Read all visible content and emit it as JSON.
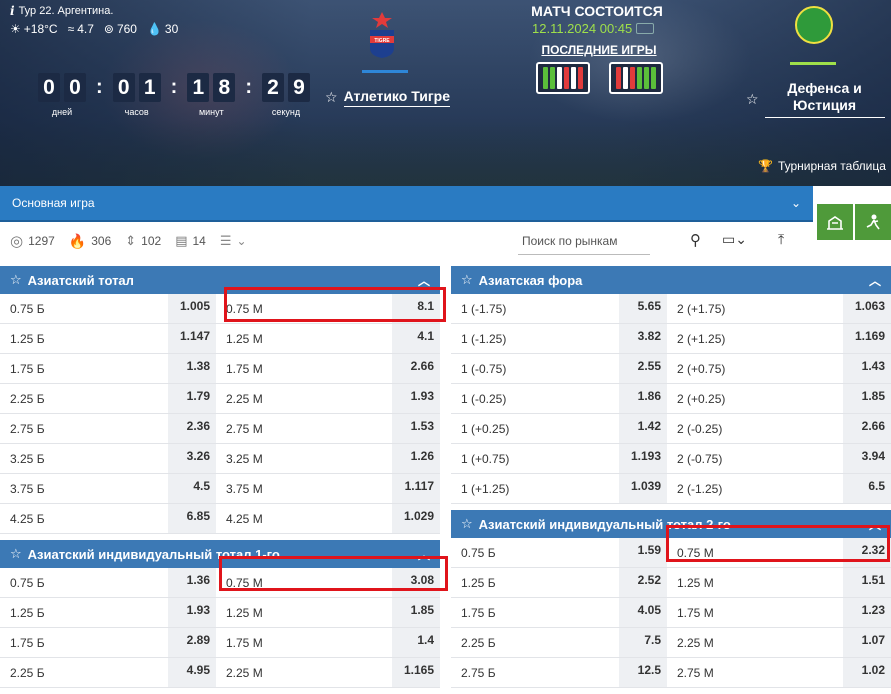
{
  "header": {
    "round": "Тур 22. Аргентина.",
    "weather": {
      "temp": "+18°C",
      "wind": "4.7",
      "pressure": "760",
      "humidity": "30"
    },
    "countdown": {
      "digits": [
        [
          "0",
          "0"
        ],
        [
          "0",
          "1"
        ],
        [
          "1",
          "8"
        ],
        [
          "2",
          "9"
        ]
      ],
      "labels": [
        "дней",
        "часов",
        "минут",
        "секунд"
      ]
    },
    "team1": {
      "name": "Атлетико Тигре",
      "logo_text": "TIGRE"
    },
    "team2": {
      "name": "Дефенса и Юстиция"
    },
    "match": {
      "status": "МАТЧ СОСТОИТСЯ",
      "datetime": "12.11.2024 00:45",
      "last_games_label": "ПОСЛЕДНИЕ ИГРЫ",
      "form_team1": [
        "g",
        "g",
        "w",
        "r",
        "w",
        "r"
      ],
      "form_team2": [
        "r",
        "w",
        "r",
        "g",
        "g",
        "g"
      ]
    },
    "tournament_link": "Турнирная таблица"
  },
  "selector": {
    "label": "Основная игра"
  },
  "filters": {
    "counts": [
      "1297",
      "306",
      "102",
      "14"
    ],
    "search_placeholder": "Поиск по рынкам"
  },
  "markets": {
    "asian_total": {
      "title": "Азиатский тотал",
      "rows": [
        [
          "0.75 Б",
          "1.005",
          "0.75 М",
          "8.1"
        ],
        [
          "1.25 Б",
          "1.147",
          "1.25 М",
          "4.1"
        ],
        [
          "1.75 Б",
          "1.38",
          "1.75 М",
          "2.66"
        ],
        [
          "2.25 Б",
          "1.79",
          "2.25 М",
          "1.93"
        ],
        [
          "2.75 Б",
          "2.36",
          "2.75 М",
          "1.53"
        ],
        [
          "3.25 Б",
          "3.26",
          "3.25 М",
          "1.26"
        ],
        [
          "3.75 Б",
          "4.5",
          "3.75 М",
          "1.117"
        ],
        [
          "4.25 Б",
          "6.85",
          "4.25 М",
          "1.029"
        ]
      ]
    },
    "asian_ind_total_1": {
      "title": "Азиатский индивидуальный тотал 1-го",
      "rows": [
        [
          "0.75 Б",
          "1.36",
          "0.75 М",
          "3.08"
        ],
        [
          "1.25 Б",
          "1.93",
          "1.25 М",
          "1.85"
        ],
        [
          "1.75 Б",
          "2.89",
          "1.75 М",
          "1.4"
        ],
        [
          "2.25 Б",
          "4.95",
          "2.25 М",
          "1.165"
        ]
      ]
    },
    "asian_handicap": {
      "title": "Азиатская фора",
      "rows": [
        [
          "1 (-1.75)",
          "5.65",
          "2 (+1.75)",
          "1.063"
        ],
        [
          "1 (-1.25)",
          "3.82",
          "2 (+1.25)",
          "1.169"
        ],
        [
          "1 (-0.75)",
          "2.55",
          "2 (+0.75)",
          "1.43"
        ],
        [
          "1 (-0.25)",
          "1.86",
          "2 (+0.25)",
          "1.85"
        ],
        [
          "1 (+0.25)",
          "1.42",
          "2 (-0.25)",
          "2.66"
        ],
        [
          "1 (+0.75)",
          "1.193",
          "2 (-0.75)",
          "3.94"
        ],
        [
          "1 (+1.25)",
          "1.039",
          "2 (-1.25)",
          "6.5"
        ]
      ]
    },
    "asian_ind_total_2": {
      "title": "Азиатский индивидуальный тотал 2-го",
      "rows": [
        [
          "0.75 Б",
          "1.59",
          "0.75 М",
          "2.32"
        ],
        [
          "1.25 Б",
          "2.52",
          "1.25 М",
          "1.51"
        ],
        [
          "1.75 Б",
          "4.05",
          "1.75 М",
          "1.23"
        ],
        [
          "2.25 Б",
          "7.5",
          "2.25 М",
          "1.07"
        ],
        [
          "2.75 Б",
          "12.5",
          "2.75 М",
          "1.02"
        ]
      ]
    }
  }
}
